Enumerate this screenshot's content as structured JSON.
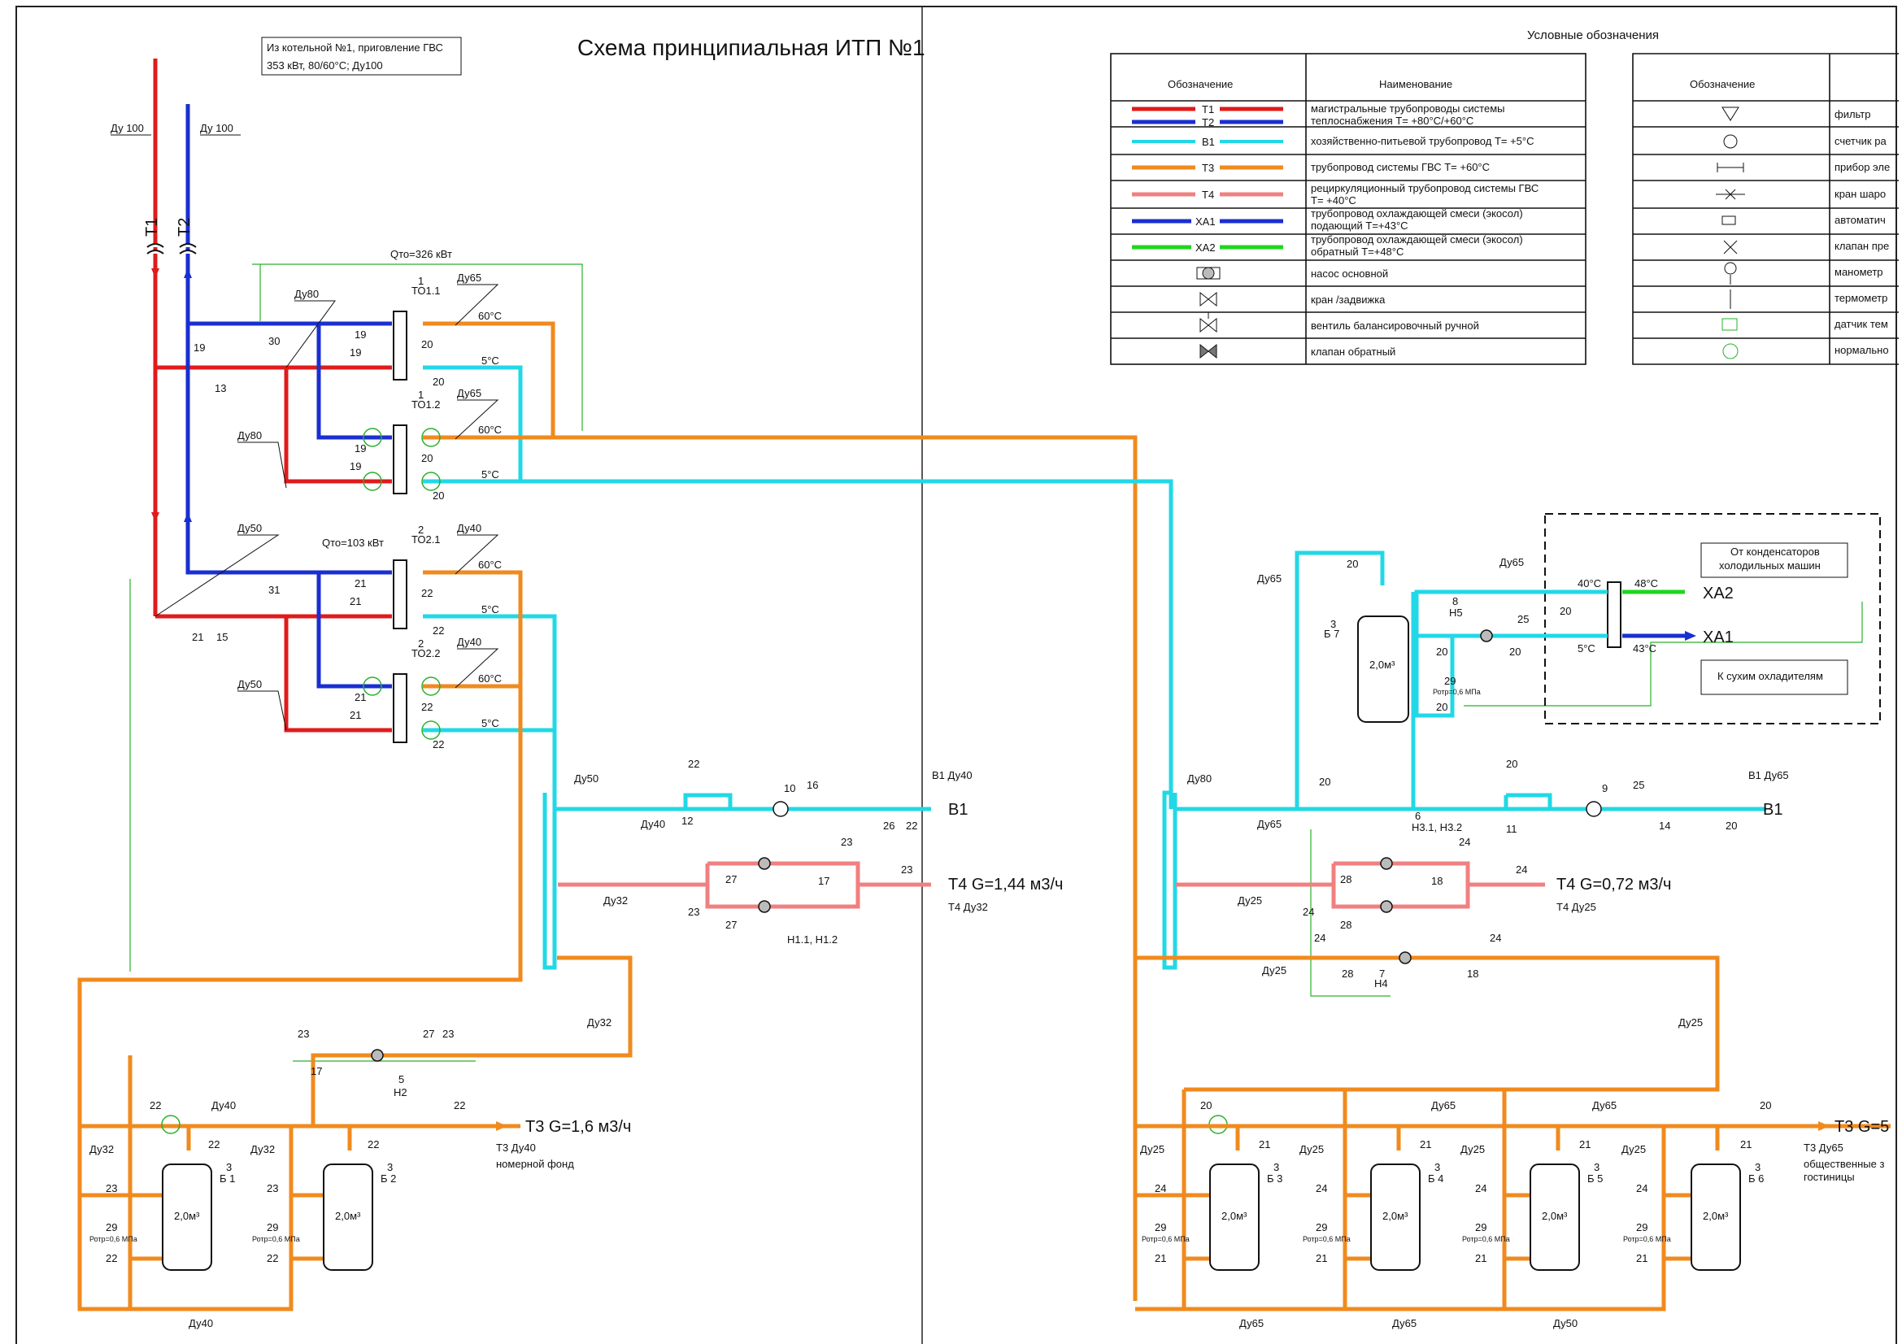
{
  "title": "Схема принципиальная ИТП №1",
  "source_note": {
    "line1": "Из котельной №1, приговление ГВС",
    "line2": "353 кВт, 80/60°С; Ду100"
  },
  "legend": {
    "caption": "Условные обозначения",
    "col_symbol": "Обозначение",
    "col_name": "Наименование",
    "rows": [
      {
        "symbol": "Т1 / Т2",
        "text1": "магистральные трубопроводы системы",
        "text2": "теплоснабжения Т= +80°С/+60°С"
      },
      {
        "symbol": "В1",
        "text1": "хозяйственно-питьевой трубопровод Т= +5°С",
        "text2": ""
      },
      {
        "symbol": "Т3",
        "text1": "трубопровод системы ГВС Т= +60°С",
        "text2": ""
      },
      {
        "symbol": "Т4",
        "text1": "рециркуляционный трубопровод системы ГВС",
        "text2": "Т= +40°С"
      },
      {
        "symbol": "ХА1",
        "text1": "трубопровод охлаждающей смеси (экосол)",
        "text2": "подающий Т=+43°С"
      },
      {
        "symbol": "ХА2",
        "text1": "трубопровод охлаждающей смеси (экосол)",
        "text2": "обратный Т=+48°С"
      },
      {
        "symbol": "",
        "text1": "насос основной",
        "text2": ""
      },
      {
        "symbol": "",
        "text1": "кран /задвижка",
        "text2": ""
      },
      {
        "symbol": "",
        "text1": "вентиль балансировочный ручной",
        "text2": ""
      },
      {
        "symbol": "",
        "text1": "клапан обратный",
        "text2": ""
      }
    ],
    "col_symbol_2": "Обозначение",
    "rows2": [
      "фильтр",
      "счетчик ра",
      "прибор эле",
      "кран шаро",
      "автоматич",
      "клапан пре",
      "манометр",
      "термометр",
      "датчик тем",
      "нормально"
    ]
  },
  "colors": {
    "t1": "#e01b1b",
    "t2": "#1a2fd1",
    "b1": "#22d8e6",
    "t3": "#f08a1e",
    "t4": "#f08080",
    "xa1": "#1a2fd1",
    "xa2": "#1fd61f",
    "control": "#2ab02a"
  },
  "labels": {
    "t1": "Т1",
    "t2": "Т2",
    "du100_a": "Ду 100",
    "du100_b": "Ду 100",
    "qto1": "Qто=326 кВт",
    "qto2": "Qто=103 кВт",
    "to11": "ТО1.1",
    "to12": "ТО1.2",
    "to21": "ТО2.1",
    "to22": "ТО2.2",
    "t60": "60°С",
    "t5": "5°С",
    "t40": "40°С",
    "t48": "48°С",
    "t43": "43°С",
    "du80": "Ду80",
    "du65": "Ду65",
    "du50": "Ду50",
    "du40": "Ду40",
    "du32": "Ду32",
    "du25": "Ду25",
    "b1": "В1",
    "b1_du40": "В1 Ду40",
    "b1_du65": "В1 Ду65",
    "t4_left": "Т4  G=1,44 м3/ч",
    "t4_left_du": "Т4 Ду32",
    "t4_right": "Т4  G=0,72 м3/ч",
    "t4_right_du": "Т4 Ду25",
    "t3_left": "Т3    G=1,6 м3/ч",
    "t3_left_du": "Т3 Ду40",
    "t3_left_sub": "номерной фонд",
    "t3_right": "Т3  G=5",
    "t3_right_du": "Т3 Ду65",
    "t3_right_sub1": "общественные з",
    "t3_right_sub2": "гостиницы",
    "h11": "Н1.1, Н1.2",
    "h2": "Н2",
    "h31": "Н3.1, Н3.2",
    "h4": "Н4",
    "h5": "Н5",
    "xa1": "ХА1",
    "xa2": "ХА2",
    "cond1": "От конденсаторов",
    "cond2": "холодильных машин",
    "dry": "К сухим охладителям",
    "b1tank": "Б 1",
    "b2tank": "Б 2",
    "b3tank": "Б 3",
    "b4tank": "Б 4",
    "b5tank": "Б 5",
    "b6tank": "Б 6",
    "b7tank": "Б 7",
    "vol": "2,0м³",
    "prot": "Ротр=0,6 МПа",
    "n1": "1",
    "n2": "2",
    "n3": "3",
    "n5": "5",
    "n6": "6",
    "n7": "7",
    "n8": "8",
    "n9": "9",
    "n10": "10",
    "n11": "11",
    "n12": "12",
    "n13": "13",
    "n14": "14",
    "n15": "15",
    "n16": "16",
    "n17": "17",
    "n18": "18",
    "n19": "19",
    "n20": "20",
    "n21": "21",
    "n22": "22",
    "n23": "23",
    "n24": "24",
    "n25": "25",
    "n26": "26",
    "n27": "27",
    "n28": "28",
    "n29": "29",
    "n30": "30",
    "n31": "31"
  }
}
